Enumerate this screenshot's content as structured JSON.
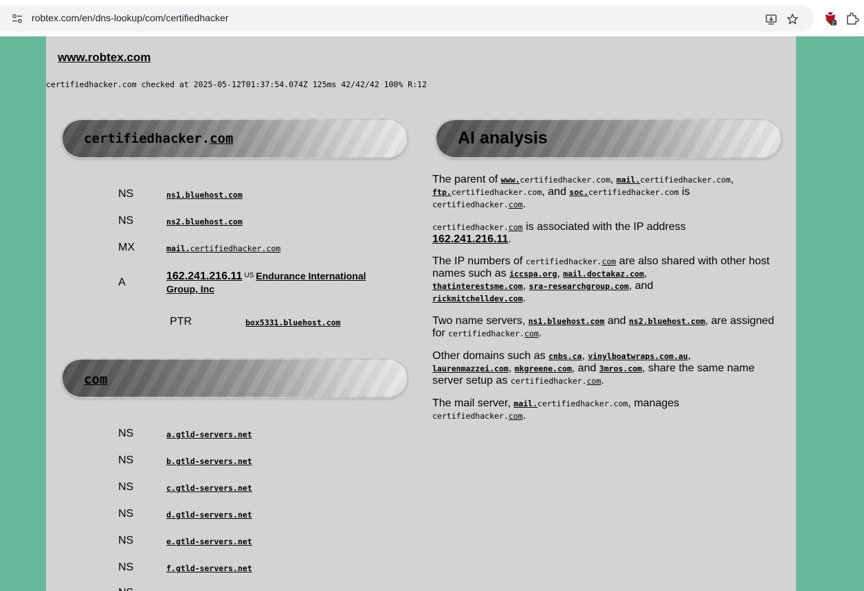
{
  "browser": {
    "url_host": "robtex.com",
    "url_path": "/en/dns-lookup/com/certifiedhacker",
    "extension_badge": "2"
  },
  "site": {
    "title": "www.robtex.com",
    "checked_line": "certifiedhacker.com checked at 2025-05-12T01:37:54.074Z 125ms 42/42/42 100% R:12"
  },
  "domain_card": {
    "title_prefix": "certifiedhacker.",
    "title_tld": "com",
    "records": [
      {
        "type": "NS",
        "value": "ns1.bluehost.com"
      },
      {
        "type": "NS",
        "value": "ns2.bluehost.com"
      },
      {
        "type": "MX",
        "value_link": "mail.",
        "value_rest": "certifiedhacker.com"
      }
    ],
    "a_record": {
      "type": "A",
      "ip": "162.241.216.11",
      "country": "US",
      "org_line1": "Endurance International",
      "org_line2": "Group, Inc"
    },
    "ptr": {
      "type": "PTR",
      "value": "box5331.bluehost.com"
    }
  },
  "tld_card": {
    "title": "com",
    "records": [
      {
        "type": "NS",
        "value": "a.gtld-servers.net"
      },
      {
        "type": "NS",
        "value": "b.gtld-servers.net"
      },
      {
        "type": "NS",
        "value": "c.gtld-servers.net"
      },
      {
        "type": "NS",
        "value": "d.gtld-servers.net"
      },
      {
        "type": "NS",
        "value": "e.gtld-servers.net"
      },
      {
        "type": "NS",
        "value": "f.gtld-servers.net"
      },
      {
        "type": "NS",
        "value": ""
      }
    ]
  },
  "ai": {
    "title": "AI analysis",
    "p1": {
      "t1": "The parent of ",
      "l1": "www.",
      "r1": "certifiedhacker.com",
      "sep1": ", ",
      "l2": "mail.",
      "r2": "certifiedhacker.com",
      "sep2": ",",
      "l3": "ftp.",
      "r3": "certifiedhacker.com",
      "and": ", and ",
      "l4": "soc.",
      "r4": "certifiedhacker.com",
      "is": " is",
      "end_a": "certifiedhacker.",
      "end_b": "com",
      "end_c": "."
    },
    "p2": {
      "a": "certifiedhacker.",
      "b": "com",
      "t": " is associated with the IP address",
      "ip": "162.241.216.11",
      "dot": "."
    },
    "p3": {
      "t1": "The IP numbers of ",
      "a": "certifiedhacker.",
      "b": "com",
      "t2": " are also shared with other host names such as ",
      "h1": "iccspa.org",
      "s1": ", ",
      "h2": "mail.doctakaz.com",
      "s2": ",",
      "h3": "thatinterestsme.com",
      "s3": ", ",
      "h4": "sra-researchgroup.com",
      "s4": ", and",
      "h5": "rickmitchelldev.com",
      "end": "."
    },
    "p4": {
      "t1": "Two name servers, ",
      "n1": "ns1.bluehost.com",
      "and": " and ",
      "n2": "ns2.bluehost.com",
      "t2": ", are assigned for ",
      "a": "certifiedhacker.",
      "b": "com",
      "end": "."
    },
    "p5": {
      "t1": "Other domains such as ",
      "d1": "cnbs.ca",
      "s1": ", ",
      "d2": "vinylboatwraps.com.au",
      "s2": ",",
      "d3": "laurenmazzei.com",
      "s3": ", ",
      "d4": "mkgreene.com",
      "s4": ", and ",
      "d5": "3mros.com",
      "t2": ", share the same name server setup as ",
      "a": "certifiedhacker.",
      "b": "com",
      "end": "."
    },
    "p6": {
      "t1": "The mail server, ",
      "l": "mail.",
      "r": "certifiedhacker.com",
      "t2": ", manages",
      "a": "certifiedhacker.",
      "b": "com",
      "end": "."
    }
  }
}
